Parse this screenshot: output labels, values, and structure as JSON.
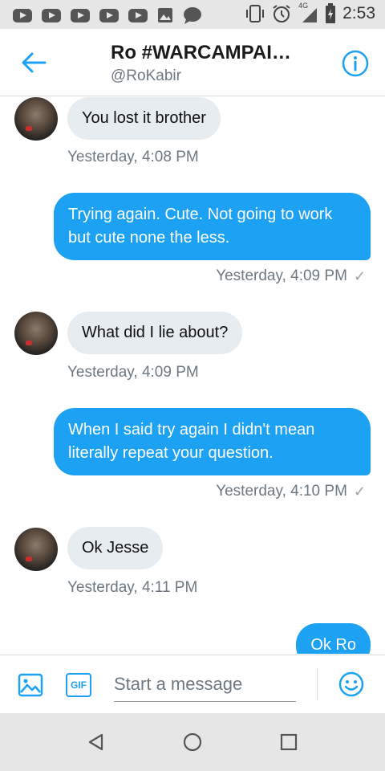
{
  "status_bar": {
    "time": "2:53",
    "network_label": "4G",
    "left_icons": [
      "youtube-icon",
      "youtube-icon",
      "youtube-icon",
      "youtube-icon",
      "youtube-icon",
      "image-icon",
      "chat-icon"
    ],
    "right_icons": [
      "vibrate-icon",
      "alarm-icon",
      "signal-icon",
      "battery-icon"
    ]
  },
  "header": {
    "title": "Ro #WARCAMPAI…",
    "handle": "@RoKabir"
  },
  "messages": [
    {
      "direction": "in",
      "text": "You lost it brother",
      "time": "Yesterday, 4:08 PM"
    },
    {
      "direction": "out",
      "text": "Trying again. Cute. Not going to work but cute none the less.",
      "time": "Yesterday, 4:09 PM",
      "status": "✓"
    },
    {
      "direction": "in",
      "text": "What did I lie about?",
      "time": "Yesterday, 4:09 PM"
    },
    {
      "direction": "out",
      "text": "When I said try again I didn't mean literally repeat your question.",
      "time": "Yesterday, 4:10 PM",
      "status": "✓"
    },
    {
      "direction": "in",
      "text": "Ok Jesse",
      "time": "Yesterday, 4:11 PM"
    },
    {
      "direction": "out",
      "text": "Ok Ro"
    }
  ],
  "composer": {
    "placeholder": "Start a message",
    "gif_label": "GIF"
  },
  "colors": {
    "accent": "#1da1f2",
    "incoming_bubble": "#e6ecf0",
    "secondary_text": "#6e7880"
  }
}
